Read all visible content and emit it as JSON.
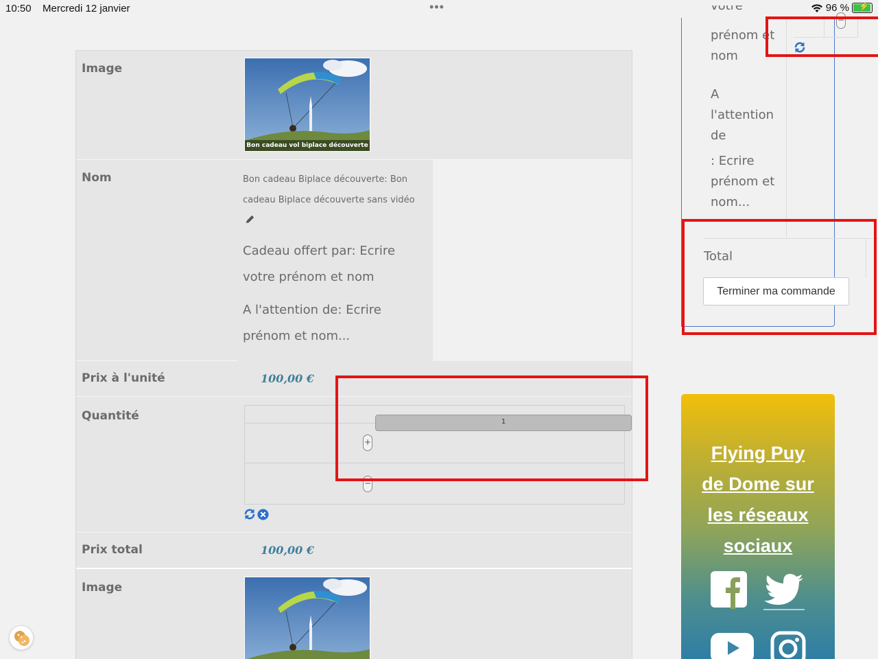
{
  "status_bar": {
    "time": "10:50",
    "date": "Mercredi 12 janvier",
    "battery": "96 %",
    "battery_level": 0.96
  },
  "cart": {
    "image_label": "Image",
    "image_caption": "Bon cadeau vol biplace découverte",
    "name_label": "Nom",
    "product_name": "Bon cadeau Biplace découverte: Bon cadeau Biplace découverte sans vidéo",
    "gift_from": "Cadeau offert par: Ecrire votre prénom et nom",
    "attention": "A l'attention de: Ecrire prénom et nom...",
    "unit_price_label": "Prix à l'unité",
    "unit_price": "100,00 €",
    "quantity_label": "Quantité",
    "quantity_value": "1",
    "plus": "+",
    "minus": "−",
    "total_price_label": "Prix total",
    "total_price": "100,00 €",
    "image2_label": "Image"
  },
  "sidebar": {
    "text_partial": "votre",
    "text_1": "prénom et",
    "text_2": "nom",
    "text_3": "A",
    "text_4": "l'attention",
    "text_5": "de",
    "text_6": ": Ecrire",
    "text_7": "prénom et",
    "text_8": "nom...",
    "total_label": "Total",
    "finish_button": "Terminer ma commande"
  },
  "social": {
    "title": "Flying Puy de Dome sur les réseaux sociaux",
    "icons": [
      "facebook-icon",
      "twitter-icon",
      "youtube-icon",
      "instagram-icon"
    ]
  },
  "colors": {
    "annotation": "#e41414",
    "price": "#3f7f99",
    "link_blue": "#2a6fcc",
    "panel_border": "#4a79c8"
  }
}
